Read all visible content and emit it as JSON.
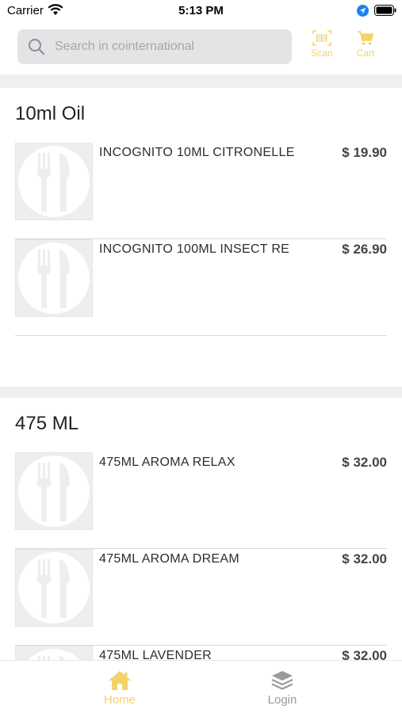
{
  "status_bar": {
    "carrier": "Carrier",
    "time": "5:13 PM"
  },
  "header": {
    "search_placeholder": "Search in cointernational",
    "scan_label": "Scan",
    "cart_label": "Cart"
  },
  "sections": [
    {
      "title": "10ml Oil",
      "items": [
        {
          "name": "INCOGNITO 10ML CITRONELLE",
          "price": "$ 19.90"
        },
        {
          "name": "INCOGNITO 100ML INSECT RE",
          "price": "$ 26.90"
        }
      ]
    },
    {
      "title": "475 ML",
      "items": [
        {
          "name": "475ML AROMA RELAX",
          "price": "$ 32.00"
        },
        {
          "name": "475ML AROMA DREAM",
          "price": "$ 32.00"
        },
        {
          "name": "475ML LAVENDER",
          "price": "$ 32.00"
        }
      ]
    }
  ],
  "tab_bar": {
    "home_label": "Home",
    "login_label": "Login"
  },
  "colors": {
    "accent": "#f3d369",
    "inactive": "#9a9a9a",
    "placeholder_bg": "#eeeeee"
  },
  "icons": {
    "search": "search-icon",
    "scan": "barcode-icon",
    "cart": "cart-icon",
    "thumb": "fork-knife-icon",
    "home": "home-icon",
    "login": "layers-icon"
  }
}
